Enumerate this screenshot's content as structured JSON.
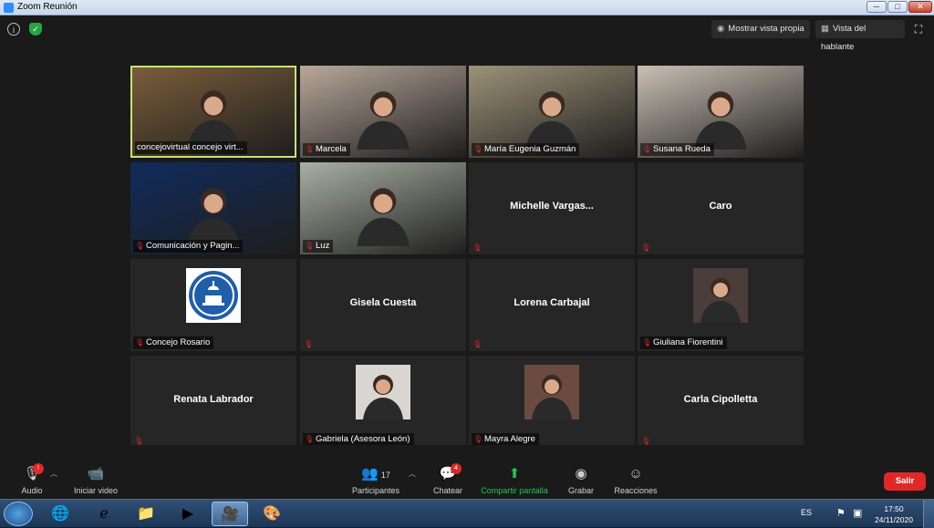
{
  "window": {
    "title": "Zoom Reunión",
    "min": "─",
    "max": "□",
    "close": "✕"
  },
  "top_bar": {
    "self_view_label": "Mostrar vista propia",
    "speaker_view_label": "Vista del hablante"
  },
  "participants": [
    {
      "name": "concejovirtual concejo virt...",
      "kind": "video",
      "highlight": true,
      "muted": false,
      "bg": "#7a5d3a"
    },
    {
      "name": "Marcela",
      "kind": "video",
      "muted": true,
      "bg": "#b8a89a"
    },
    {
      "name": "María Eugenia Guzmán",
      "kind": "video",
      "muted": true,
      "bg": "#9c9278"
    },
    {
      "name": "Susana Rueda",
      "kind": "video",
      "muted": true,
      "bg": "#c9c0b3"
    },
    {
      "name": "Comunicación y Pagin...",
      "kind": "video",
      "muted": true,
      "bg": "#102b5c"
    },
    {
      "name": "Luz",
      "kind": "video",
      "muted": true,
      "bg": "#a9b0a4"
    },
    {
      "name": "Michelle  Vargas...",
      "kind": "name",
      "muted": true
    },
    {
      "name": "Caro",
      "kind": "name",
      "muted": true
    },
    {
      "name": "Concejo Rosario",
      "kind": "logo",
      "muted": true
    },
    {
      "name": "Gisela Cuesta",
      "kind": "name",
      "muted": true
    },
    {
      "name": "Lorena Carbajal",
      "kind": "name",
      "muted": true
    },
    {
      "name": "Giuliana Fiorentini",
      "kind": "photo",
      "muted": true,
      "bg": "#4a3d3a"
    },
    {
      "name": "Renata Labrador",
      "kind": "name",
      "muted": true
    },
    {
      "name": "Gabriela (Asesora León)",
      "kind": "photo",
      "muted": true,
      "bg": "#d9d5d0"
    },
    {
      "name": "Mayra Alegre",
      "kind": "photo",
      "muted": true,
      "bg": "#6b4a3f"
    },
    {
      "name": "Carla Cipolletta",
      "kind": "name",
      "muted": true
    }
  ],
  "toolbar": {
    "audio": "Audio",
    "video": "Iniciar video",
    "participants": "Participantes",
    "participants_count": "17",
    "chat": "Chatear",
    "chat_badge": "4",
    "audio_badge": "!",
    "share": "Compartir pantalla",
    "record": "Grabar",
    "reactions": "Reacciones",
    "leave": "Salir"
  },
  "taskbar": {
    "lang": "ES",
    "time": "17:50",
    "date": "24/11/2020"
  },
  "colors": {
    "accent_green": "#23c552",
    "danger": "#e02828",
    "highlight": "#c6e377"
  }
}
